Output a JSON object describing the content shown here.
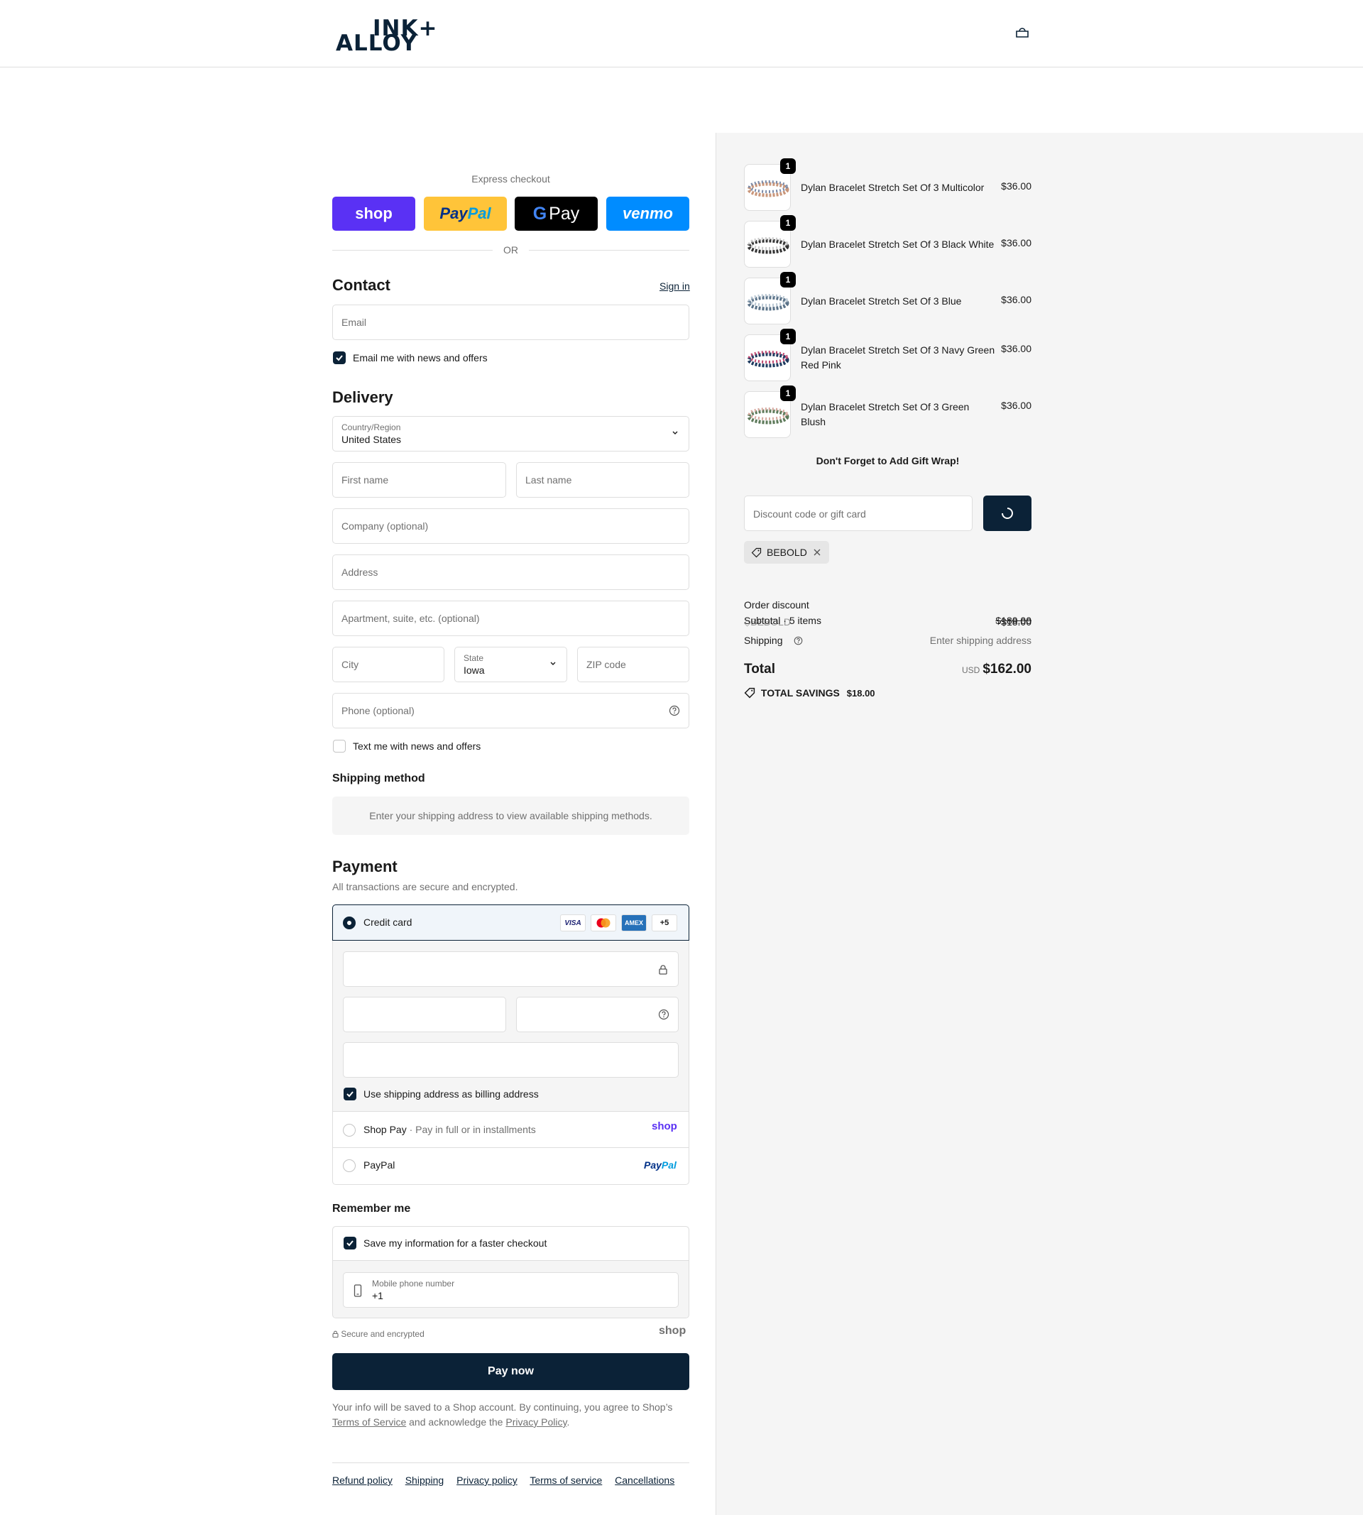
{
  "brand": {
    "logo_line1": "INK+",
    "logo_line2": "ALLOY"
  },
  "express": {
    "label": "Express checkout",
    "shop_label": "shop",
    "paypal_label_a": "Pay",
    "paypal_label_b": "Pal",
    "gpay_label_g": "G",
    "gpay_label": "Pay",
    "venmo_label": "venmo",
    "or_label": "OR"
  },
  "contact": {
    "title": "Contact",
    "sign_in": "Sign in",
    "email_placeholder": "Email",
    "news_label": "Email me with news and offers"
  },
  "delivery": {
    "title": "Delivery",
    "country_label": "Country/Region",
    "country_value": "United States",
    "first_name": "First name",
    "last_name": "Last name",
    "company": "Company (optional)",
    "address": "Address",
    "apartment": "Apartment, suite, etc. (optional)",
    "city": "City",
    "state_label": "State",
    "state_value": "Iowa",
    "zip": "ZIP code",
    "phone": "Phone (optional)",
    "text_label": "Text me with news and offers"
  },
  "shipping_method": {
    "title": "Shipping method",
    "notice": "Enter your shipping address to view available shipping methods."
  },
  "payment": {
    "title": "Payment",
    "subtitle": "All transactions are secure and encrypted.",
    "credit_card": "Credit card",
    "cards": [
      "VISA",
      "",
      "AMEX",
      "+5"
    ],
    "billing_label": "Use shipping address as billing address",
    "shop_pay": "Shop Pay",
    "shop_pay_sub": "Pay in full or in installments",
    "shop_pay_logo": "shop",
    "paypal": "PayPal",
    "paypal_logo_a": "Pay",
    "paypal_logo_b": "Pal"
  },
  "remember": {
    "title": "Remember me",
    "save_label": "Save my information for a faster checkout",
    "mobile_label": "Mobile phone number",
    "mobile_value": "+1",
    "secure_label": "Secure and encrypted",
    "shop_logo": "shop"
  },
  "pay_now": "Pay now",
  "legal": {
    "text1": "Your info will be saved to a Shop account. By continuing, you agree to Shop’s",
    "tos": "Terms of Service",
    "text2": "and acknowledge the",
    "privacy": "Privacy Policy",
    "period": "."
  },
  "footer_links": [
    "Refund policy",
    "Shipping",
    "Privacy policy",
    "Terms of service",
    "Cancellations"
  ],
  "summary": {
    "items": [
      {
        "name": "Dylan Bracelet Stretch Set Of 3 Multicolor",
        "price": "$36.00",
        "qty": "1"
      },
      {
        "name": "Dylan Bracelet Stretch Set Of 3 Black White",
        "price": "$36.00",
        "qty": "1"
      },
      {
        "name": "Dylan Bracelet Stretch Set Of 3 Blue",
        "price": "$36.00",
        "qty": "1"
      },
      {
        "name": "Dylan Bracelet Stretch Set Of 3 Navy Green Red Pink",
        "price": "$36.00",
        "qty": "1"
      },
      {
        "name": "Dylan Bracelet Stretch Set Of 3 Green Blush",
        "price": "$36.00",
        "qty": "1"
      }
    ],
    "gift_wrap": "Don't Forget to Add Gift Wrap!",
    "discount_placeholder": "Discount code or gift card",
    "code": "BEBOLD",
    "order_discount": "Order discount",
    "code_overlay": "BEBOLD",
    "subtotal_label": "Subtotal · 5 items",
    "subtotal_strike": "$180.00",
    "subtotal_value": "-$18.00",
    "shipping_label": "Shipping",
    "shipping_value": "Enter shipping address",
    "total_label": "Total",
    "currency": "USD",
    "total_value": "$162.00",
    "savings_label": "TOTAL SAVINGS",
    "savings_value": "$18.00"
  }
}
